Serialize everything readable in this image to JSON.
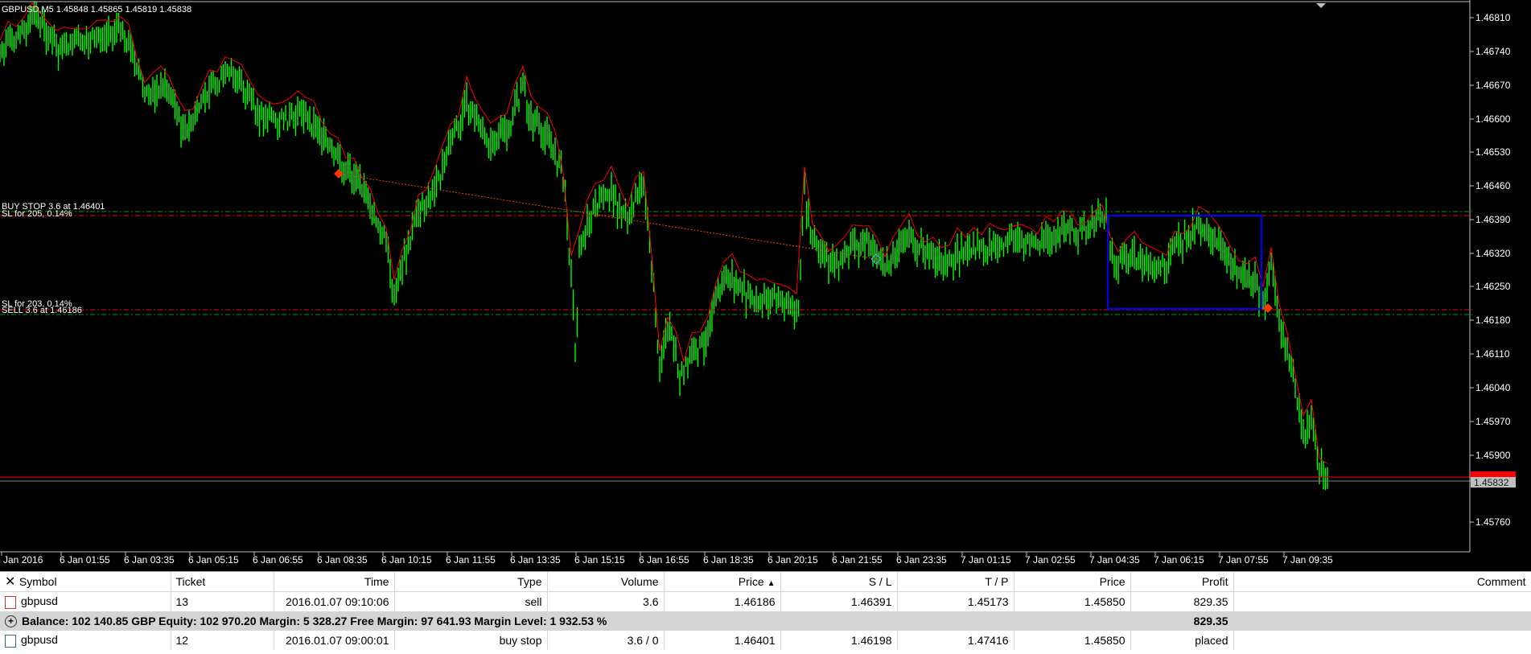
{
  "chart": {
    "header": "GBPUSD,M5  1.45848 1.45865 1.45819 1.45838",
    "price_ticks": [
      "1.46810",
      "1.46740",
      "1.46670",
      "1.46600",
      "1.46530",
      "1.46460",
      "1.46390",
      "1.46320",
      "1.46250",
      "1.46180",
      "1.46110",
      "1.46040",
      "1.45970",
      "1.45900",
      "1.45760"
    ],
    "current_price_label": "1.45832",
    "bid_red_label": "1.45848",
    "time_ticks": [
      "6 Jan 2016",
      "6 Jan 01:55",
      "6 Jan 03:35",
      "6 Jan 05:15",
      "6 Jan 06:55",
      "6 Jan 08:35",
      "6 Jan 10:15",
      "6 Jan 11:55",
      "6 Jan 13:35",
      "6 Jan 15:15",
      "6 Jan 16:55",
      "6 Jan 18:35",
      "6 Jan 20:15",
      "6 Jan 21:55",
      "6 Jan 23:35",
      "7 Jan 01:15",
      "7 Jan 02:55",
      "7 Jan 04:35",
      "7 Jan 06:15",
      "7 Jan 07:55",
      "7 Jan 09:35"
    ],
    "labels": {
      "buy_stop": "BUY STOP 3.6 at 1.46401",
      "sl_205": "SL for 205, 0.14%",
      "sl_203": "SL for 203, 0.14%",
      "sell": "SELL 3.6 at 1.46186"
    },
    "colors": {
      "candle": "#00ff00",
      "high_line": "#ff0000",
      "rectangle": "#0000ff",
      "level_green": "#00a000",
      "level_red": "#ff0000"
    }
  },
  "terminal": {
    "columns": [
      "Symbol",
      "Ticket",
      "Time",
      "Type",
      "Volume",
      "Price",
      "S / L",
      "T / P",
      "Price",
      "Profit",
      "Comment"
    ],
    "sort_indicator": "▲",
    "rows": [
      {
        "symbol": "gbpusd",
        "ticket": "13",
        "time": "2016.01.07 09:10:06",
        "type": "sell",
        "volume": "3.6",
        "price": "1.46186",
        "sl": "1.46391",
        "tp": "1.45173",
        "cur_price": "1.45850",
        "profit": "829.35",
        "comment": ""
      }
    ],
    "balance": {
      "text": "Balance: 102 140.85 GBP  Equity: 102 970.20  Margin: 5 328.27  Free Margin: 97 641.93  Margin Level: 1 932.53 %",
      "profit": "829.35"
    },
    "orders": [
      {
        "symbol": "gbpusd",
        "ticket": "12",
        "time": "2016.01.07 09:00:01",
        "type": "buy stop",
        "volume": "3.6 / 0",
        "price": "1.46401",
        "sl": "1.46198",
        "tp": "1.47416",
        "cur_price": "1.45850",
        "profit": "placed",
        "comment": ""
      }
    ]
  }
}
